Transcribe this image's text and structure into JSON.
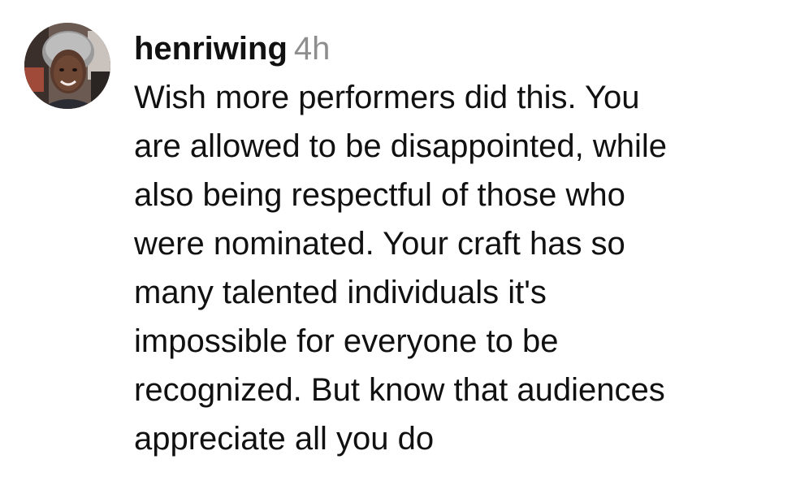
{
  "comment": {
    "username": "henriwing",
    "timestamp": "4h",
    "avatar_icon": "user-avatar",
    "lines": [
      "Wish more performers did this. You",
      "are allowed to be disappointed, while",
      "also being respectful of those who",
      "were nominated. Your craft has so",
      "many talented individuals it's",
      "impossible for everyone to be",
      "recognized. But know that audiences",
      "appreciate all you do"
    ]
  }
}
